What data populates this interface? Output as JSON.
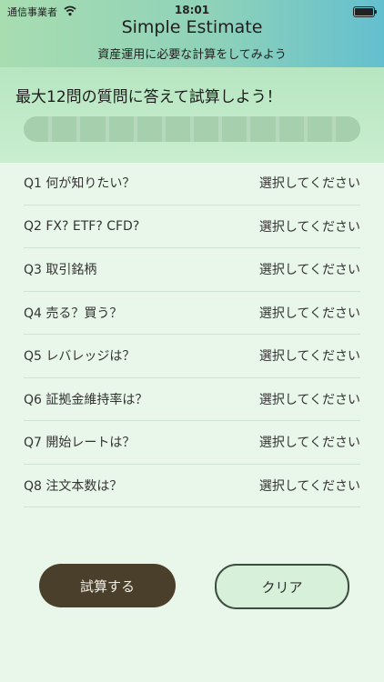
{
  "status_bar": {
    "carrier": "通信事業者",
    "time": "18:01"
  },
  "header": {
    "title": "Simple Estimate",
    "subtitle": "資産運用に必要な計算をしてみよう"
  },
  "banner": {
    "lead": "最大12問の質問に答えて試算しよう！",
    "progress": {
      "completed": 0,
      "total": 12
    }
  },
  "questions": [
    {
      "label": "Q1 何が知りたい？",
      "value": "選択してください"
    },
    {
      "label": "Q2 FX? ETF? CFD?",
      "value": "選択してください"
    },
    {
      "label": "Q3 取引銘柄",
      "value": "選択してください"
    },
    {
      "label": "Q4 売る？買う？",
      "value": "選択してください"
    },
    {
      "label": "Q5 レバレッジは？",
      "value": "選択してください"
    },
    {
      "label": "Q6 証拠金維持率は？",
      "value": "選択してください"
    },
    {
      "label": "Q7 開始レートは？",
      "value": "選択してください"
    },
    {
      "label": "Q8 注文本数は？",
      "value": "選択してください"
    }
  ],
  "buttons": {
    "run": "試算する",
    "clear": "クリア"
  },
  "colors": {
    "run_button": "#4a3f2a",
    "clear_button": "#d7f0d9",
    "header_start": "#a8ddb0",
    "header_end": "#63bfcf"
  }
}
